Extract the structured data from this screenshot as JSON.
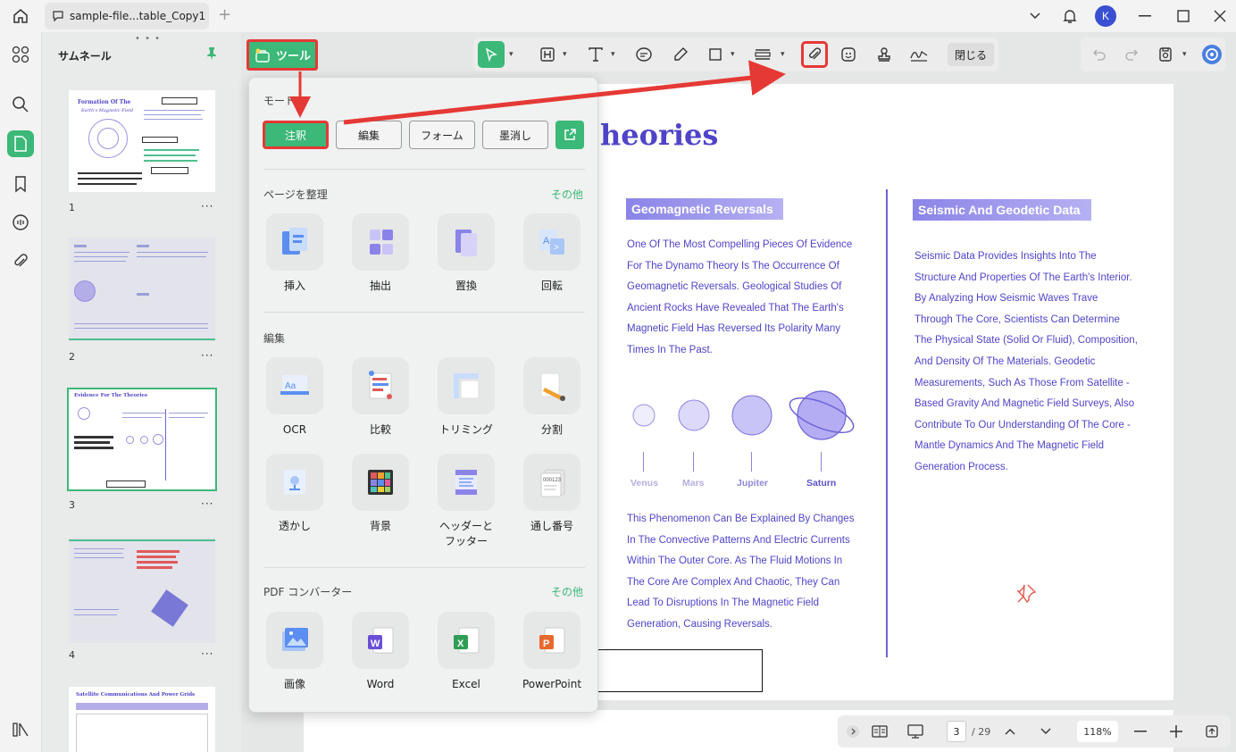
{
  "titlebar": {
    "tab_title": "sample-file...table_Copy1",
    "avatar_initial": "K"
  },
  "thumbnails": {
    "title": "サムネール",
    "pages": [
      {
        "num": "1",
        "heading": "Formation Of The",
        "heading2": "Earth's Magnetic Field"
      },
      {
        "num": "2"
      },
      {
        "num": "3",
        "heading": "Evidence For The Theories"
      },
      {
        "num": "4"
      },
      {
        "heading": "Satellite Communications And Power Grids"
      }
    ],
    "more": "···"
  },
  "toolbar": {
    "tools_label": "ツール",
    "close_label": "閉じる"
  },
  "popup": {
    "mode_label": "モード",
    "modes": [
      "注釈",
      "編集",
      "フォーム",
      "墨消し"
    ],
    "organize_label": "ページを整理",
    "organize_more": "その他",
    "organize": [
      "挿入",
      "抽出",
      "置換",
      "回転"
    ],
    "edit_label": "編集",
    "edit": [
      "OCR",
      "比較",
      "トリミング",
      "分割",
      "透かし",
      "背景",
      "ヘッダーと\nフッター",
      "通し番号"
    ],
    "converter_label": "PDF コンバーター",
    "converter_more": "その他",
    "converter": [
      "画像",
      "Word",
      "Excel",
      "PowerPoint"
    ]
  },
  "document": {
    "heading": "heories",
    "left_badge": "Geomagnetic Reversals",
    "left_para1": [
      "One Of The Most Compelling Pieces Of Evidence",
      "For The Dynamo Theory Is The Occurrence Of",
      "Geomagnetic Reversals. Geological Studies Of",
      "Ancient Rocks Have Revealed That The Earth's",
      "Magnetic Field Has Reversed Its Polarity Many",
      "Times In The Past."
    ],
    "planets": [
      "Venus",
      "Mars",
      "Jupiter",
      "Saturn"
    ],
    "left_para2": [
      "This Phenomenon Can Be Explained By Changes",
      "In The Convective Patterns And Electric Currents",
      "Within The Outer Core. As The Fluid Motions In",
      "The Core Are Complex And Chaotic, They Can",
      "Lead To Disruptions In The Magnetic Field",
      "Generation, Causing Reversals."
    ],
    "right_badge": "Seismic And Geodetic Data",
    "right_para": [
      "Seismic Data Provides Insights Into The",
      "Structure And Properties Of The Earth's Interior.",
      "By Analyzing How Seismic Waves Trave",
      "Through The Core, Scientists Can Determine",
      "The Physical State (Solid Or Fluid), Composition,",
      "And Density Of The Materials. Geodetic",
      "Measurements, Such As Those From Satellite -",
      "Based Gravity And Magnetic Field Surveys, Also",
      "Contribute To Our Understanding Of The Core -",
      "Mantle Dynamics And The Magnetic Field",
      "Generation Process."
    ]
  },
  "bottombar": {
    "current_page": "3",
    "total_pages": "/ 29",
    "zoom": "118%"
  },
  "colors": {
    "accent": "#3cb878",
    "highlight": "#e53935",
    "doc_text": "#4f44c9"
  }
}
